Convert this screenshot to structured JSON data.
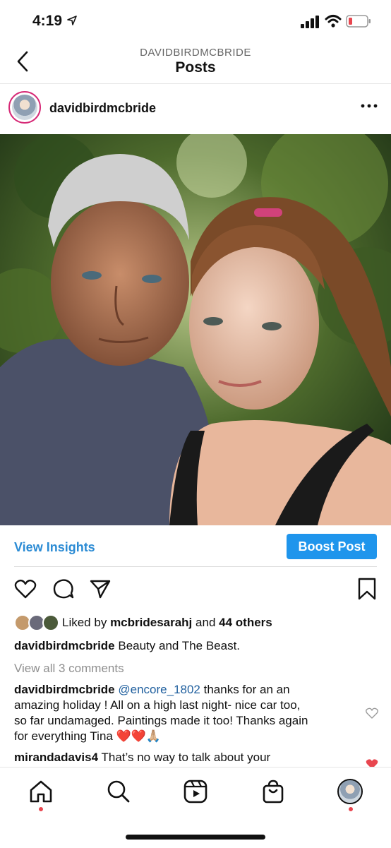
{
  "status_bar": {
    "time": "4:19",
    "location_arrow": "location-arrow-icon",
    "signal": "signal-icon",
    "wifi": "wifi-icon",
    "battery": "battery-low-icon"
  },
  "nav": {
    "subtitle": "DAVIDBIRDMCBRIDE",
    "title": "Posts",
    "back_icon": "chevron-left-icon"
  },
  "post": {
    "username": "davidbirdmcbride",
    "more_icon": "more-horizontal-icon",
    "image_alt": "selfie photo",
    "view_insights": "View Insights",
    "boost_post": "Boost Post",
    "liked_by_prefix": "Liked by",
    "liked_by_user": "mcbridesarahj",
    "liked_by_and": "and",
    "liked_by_others": "44 others",
    "caption_user": "davidbirdmcbride",
    "caption_text": "Beauty and The Beast.",
    "view_all_comments": "View all 3 comments"
  },
  "comments": [
    {
      "user": "davidbirdmcbride",
      "mention": "@encore_1802",
      "lines": [
        "thanks for an an",
        "amazing holiday ! All on a high last night- nice car too,",
        "so far undamaged. Paintings made it too! Thanks again",
        "for everything Tina ❤️❤️🙏🏼"
      ]
    },
    {
      "user": "mirandadavis4",
      "text": "That’s no way to talk about your"
    }
  ],
  "tabbar": [
    "home-icon",
    "search-icon",
    "reels-icon",
    "shop-icon",
    "profile-avatar"
  ],
  "colors": {
    "link": "#2b8bd4",
    "boost_bg": "#1f95ec",
    "heart_red": "#e8464f",
    "notif_dot": "#e8464f"
  }
}
